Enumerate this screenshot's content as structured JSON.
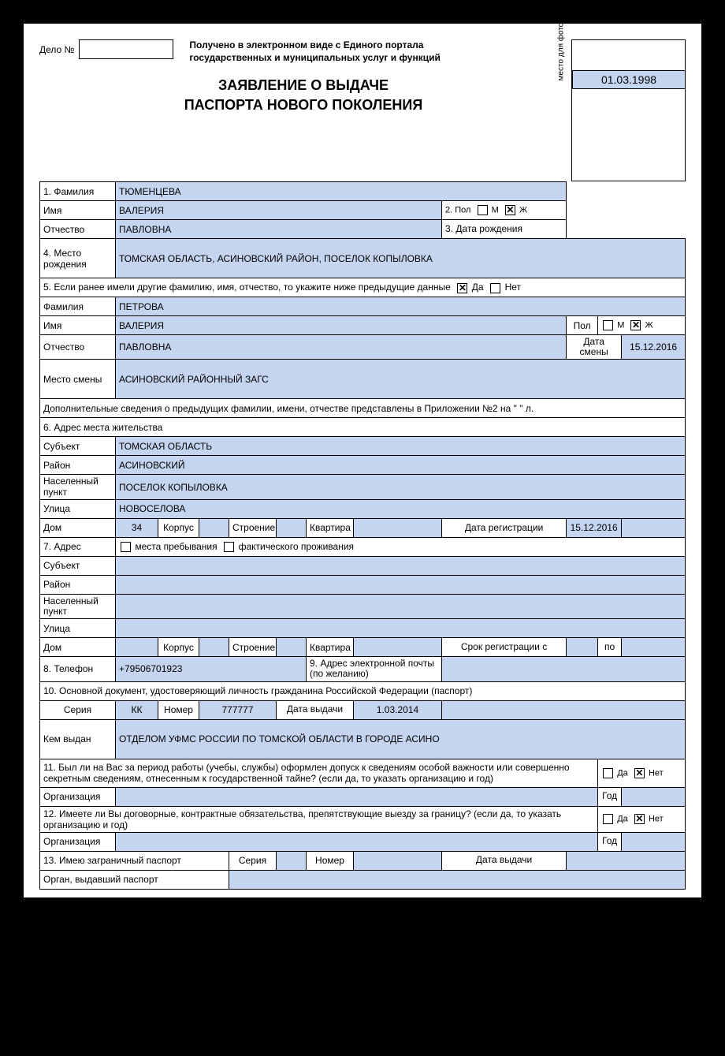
{
  "header": {
    "delo_label": "Дело №",
    "received": "Получено в электронном виде с Единого портала государственных и муниципальных услуг и функций",
    "photo_label": "место для фотографии",
    "title_line1": "ЗАЯВЛЕНИЕ О ВЫДАЧЕ",
    "title_line2": "ПАСПОРТА НОВОГО ПОКОЛЕНИЯ"
  },
  "labels": {
    "f1": "1. Фамилия",
    "f1_imya": "Имя",
    "f1_otch": "Отчество",
    "f2": "2. Пол",
    "m": "М",
    "zh": "Ж",
    "f3": "3. Дата рождения",
    "f4": "4. Место рождения",
    "f5": "5. Если ранее имели другие фамилию, имя, отчество, то укажите ниже предыдущие данные",
    "da": "Да",
    "net": "Нет",
    "fam": "Фамилия",
    "imya": "Имя",
    "otch": "Отчество",
    "pol": "Пол",
    "data_smeny": "Дата смены",
    "mesto_smeny": "Место смены",
    "dop": "Дополнительные сведения о предыдущих фамилии, имени, отчестве представлены в Приложении №2 на \"       \" л.",
    "f6": "6. Адрес места жительства",
    "subject": "Субъект",
    "rayon": "Район",
    "nas_punkt": "Населенный пункт",
    "ulitsa": "Улица",
    "dom": "Дом",
    "korpus": "Корпус",
    "stroenie": "Строение",
    "kvartira": "Квартира",
    "data_reg": "Дата регистрации",
    "f7": "7. Адрес",
    "mesta_preb": "места пребывания",
    "fakt_prozh": "фактического проживания",
    "srok_reg_s": "Срок регистрации с",
    "po": "по",
    "f8": "8. Телефон",
    "f9": "9. Адрес электронной почты (по желанию)",
    "f10": "10. Основной документ, удостоверяющий личность гражданина Российской Федерации (паспорт)",
    "seria": "Серия",
    "nomer": "Номер",
    "data_vyd": "Дата выдачи",
    "kem_vyd": "Кем выдан",
    "f11": "11. Был ли на Вас за период работы (учебы, службы) оформлен допуск к сведениям особой важности или совершенно секретным сведениям, отнесенным к государственной тайне? (если да, то указать организацию и год)",
    "org": "Организация",
    "god": "Год",
    "f12": "12. Имеете ли Вы договорные, контрактные обязательства, препятствующие выезду за границу? (если да, то указать организацию и год)",
    "f13": "13. Имею заграничный паспорт",
    "organ_vyd": "Орган, выдавший паспорт"
  },
  "values": {
    "surname": "ТЮМЕНЦЕВА",
    "name": "ВАЛЕРИЯ",
    "patronymic": "ПАВЛОВНА",
    "birth_date": "01.03.1998",
    "birth_place": "ТОМСКАЯ ОБЛАСТЬ, АСИНОВСКИЙ РАЙОН, ПОСЕЛОК КОПЫЛОВКА",
    "prev_surname": "ПЕТРОВА",
    "prev_name": "ВАЛЕРИЯ",
    "prev_patronymic": "ПАВЛОВНА",
    "change_date": "15.12.2016",
    "change_place": "АСИНОВСКИЙ РАЙОННЫЙ ЗАГС",
    "addr_subject": "ТОМСКАЯ ОБЛАСТЬ",
    "addr_rayon": "АСИНОВСКИЙ",
    "addr_nas": "ПОСЕЛОК КОПЫЛОВКА",
    "addr_street": "НОВОСЕЛОВА",
    "addr_dom": "34",
    "reg_date": "15.12.2016",
    "phone": "+79506701923",
    "pass_seria": "КК",
    "pass_nomer": "777777",
    "pass_date": "1.03.2014",
    "pass_issuer": "ОТДЕЛОМ УФМС РОССИИ ПО ТОМСКОЙ ОБЛАСТИ В ГОРОДЕ АСИНО"
  }
}
